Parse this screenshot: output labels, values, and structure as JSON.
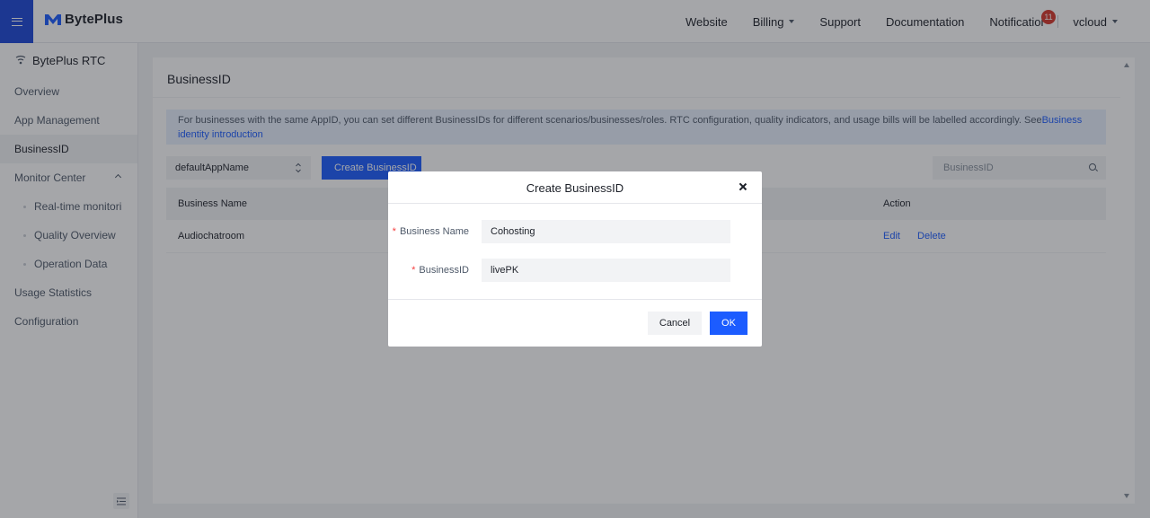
{
  "header": {
    "brand": "BytePlus",
    "nav": [
      {
        "label": "Website",
        "has_dropdown": false
      },
      {
        "label": "Billing",
        "has_dropdown": true
      },
      {
        "label": "Support",
        "has_dropdown": false
      },
      {
        "label": "Documentation",
        "has_dropdown": false
      },
      {
        "label": "Notifications",
        "has_dropdown": false
      }
    ],
    "notification_count": "11",
    "user": "vcloud",
    "accent_color": "#1c47d8"
  },
  "sidebar": {
    "product": "BytePlus RTC",
    "items": [
      {
        "label": "Overview"
      },
      {
        "label": "App Management"
      },
      {
        "label": "BusinessID",
        "active": true
      },
      {
        "label": "Monitor Center",
        "expanded": true
      },
      {
        "label": "Real-time monitori",
        "sub": true
      },
      {
        "label": "Quality Overview",
        "sub": true
      },
      {
        "label": "Operation Data",
        "sub": true
      },
      {
        "label": "Usage Statistics"
      },
      {
        "label": "Configuration"
      }
    ]
  },
  "main": {
    "title": "BusinessID",
    "info_text": "For businesses with the same AppID, you can set different BusinessIDs for different scenarios/businesses/roles. RTC configuration, quality indicators, and usage bills will be labelled accordingly. See",
    "info_link": "Business identity introduction",
    "app_select_value": "defaultAppName",
    "create_button": "Create BusinessID",
    "search_placeholder": "BusinessID",
    "table": {
      "columns": [
        "Business Name",
        "Action"
      ],
      "rows": [
        {
          "name": "Audiochatroom",
          "actions": [
            "Edit",
            "Delete"
          ]
        }
      ]
    }
  },
  "modal": {
    "title": "Create BusinessID",
    "fields": [
      {
        "label": "Business Name",
        "value": "Cohosting",
        "required": true
      },
      {
        "label": "BusinessID",
        "value": "livePK",
        "required": true
      }
    ],
    "cancel_label": "Cancel",
    "ok_label": "OK"
  }
}
